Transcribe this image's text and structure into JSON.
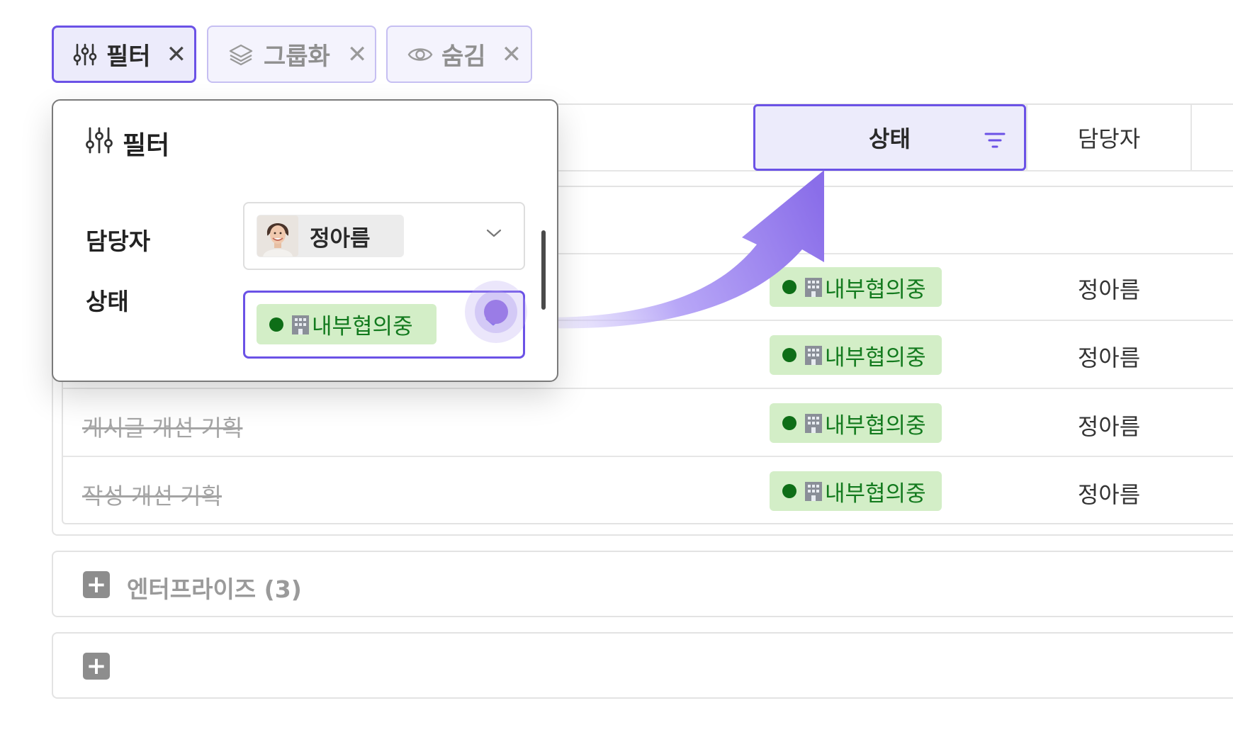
{
  "toolbar": {
    "filter_label": "필터",
    "group_label": "그룹화",
    "hide_label": "숨김",
    "close_symbol": "✕"
  },
  "table": {
    "columns": {
      "status": "상태",
      "owner": "담당자"
    },
    "rows": [
      {
        "title": "",
        "status": "내부협의중",
        "owner": "정아름"
      },
      {
        "title": "",
        "status": "내부협의중",
        "owner": "정아름"
      },
      {
        "title": "게시글 개선 기획",
        "status": "내부협의중",
        "owner": "정아름"
      },
      {
        "title": "작성 개선 기획",
        "status": "내부협의중",
        "owner": "정아름"
      }
    ]
  },
  "groups": [
    {
      "label": "엔터프라이즈 (3)"
    },
    {
      "label": ""
    }
  ],
  "filter_popover": {
    "title": "필터",
    "owner_label": "담당자",
    "owner_value": "정아름",
    "status_label": "상태",
    "status_value": "내부협의중"
  },
  "icons": {
    "filter": "sliders-icon",
    "group": "layers-icon",
    "hide": "eye-icon",
    "column_filter": "filter-lines-icon",
    "status_emoji": "office-building-icon",
    "dropdown": "chevron-down-icon",
    "add": "plus-icon"
  },
  "colors": {
    "accent": "#6b52e6",
    "accent_light": "#ecebfb",
    "status_bg": "#d3eec7",
    "status_text": "#137a1e",
    "status_dot": "#0e6e17"
  }
}
